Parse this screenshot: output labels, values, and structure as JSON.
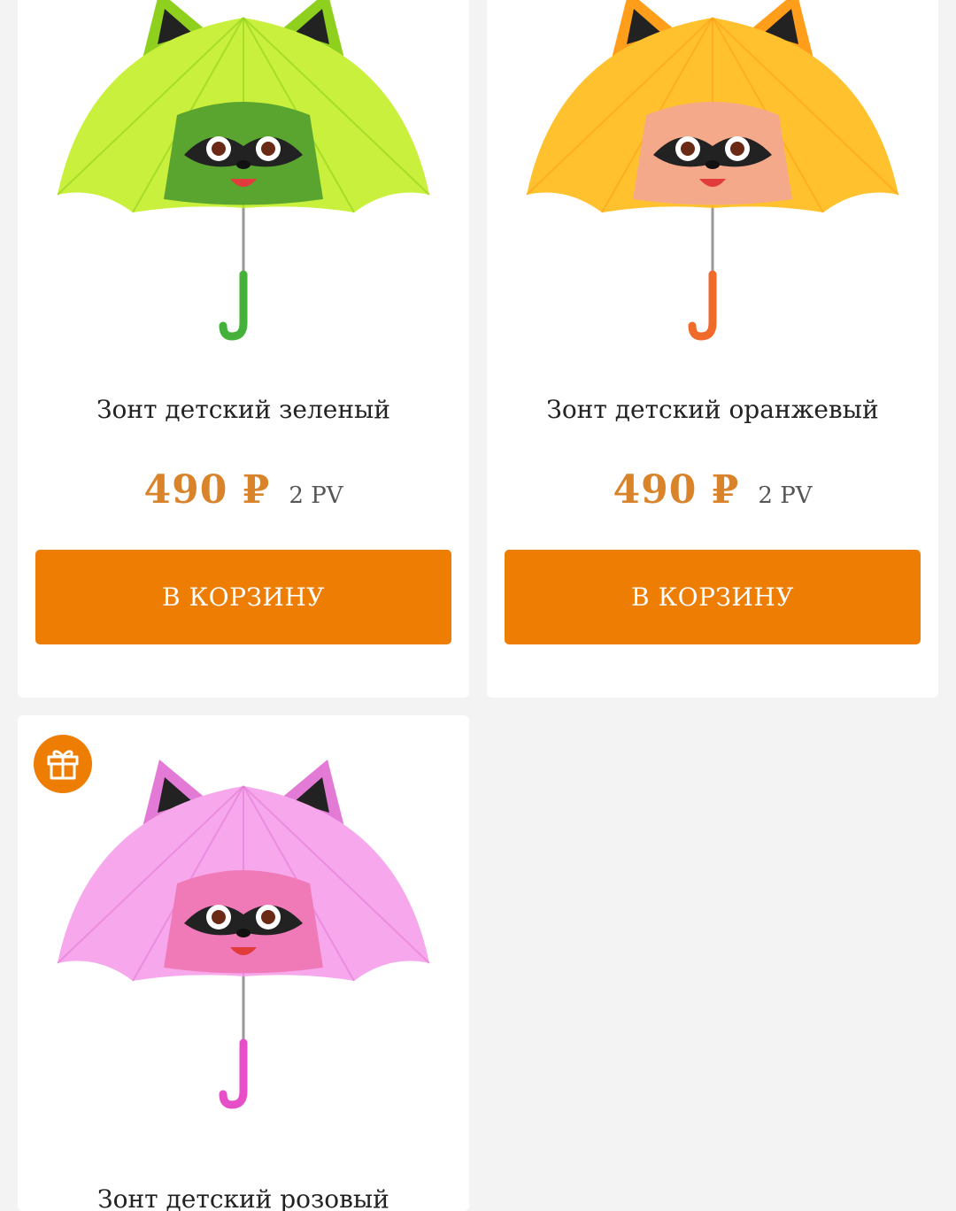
{
  "theme": {
    "accent": "#ee7d04",
    "price_color": "#d9832a",
    "background": "#f3f3f3",
    "card": "#ffffff"
  },
  "products": [
    {
      "title": "Зонт детский зеленый",
      "price": "490 ₽",
      "pv": "2 PV",
      "button_label": "В КОРЗИНУ",
      "canopy_color": "#c9f03c",
      "canopy_dark": "#8fd01f",
      "face_color": "#5aa530",
      "handle_color": "#44b23a",
      "gift_icon": "gift-icon"
    },
    {
      "title": "Зонт детский оранжевый",
      "price": "490 ₽",
      "pv": "2 PV",
      "button_label": "В КОРЗИНУ",
      "canopy_color": "#ffc22e",
      "canopy_dark": "#ff9e1a",
      "face_color": "#f4a98a",
      "handle_color": "#f06a2a",
      "gift_icon": "gift-icon"
    },
    {
      "title": "Зонт детский розовый",
      "canopy_color": "#f7a8ec",
      "canopy_dark": "#e27ad6",
      "face_color": "#f07ab8",
      "handle_color": "#e64fc8",
      "gift_icon": "gift-icon"
    }
  ]
}
